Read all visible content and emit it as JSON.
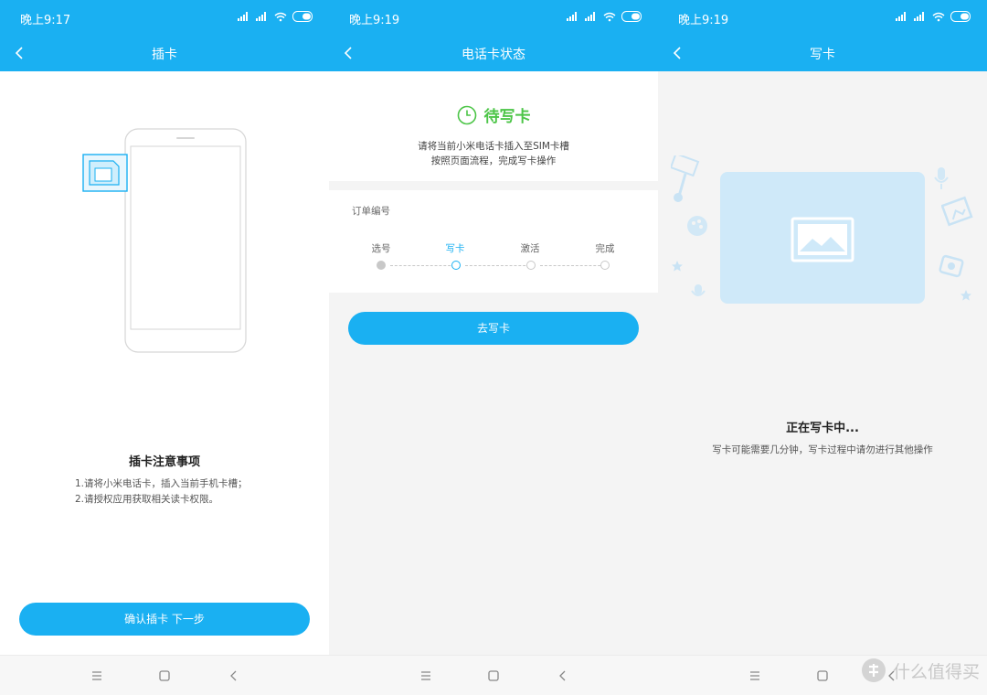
{
  "screens": [
    {
      "status_time": "晚上9:17",
      "title": "插卡",
      "heading": "插卡注意事项",
      "notes": [
        "1.请将小米电话卡，插入当前手机卡槽；",
        "2.请授权应用获取相关读卡权限。"
      ],
      "button_label": "确认插卡 下一步"
    },
    {
      "status_time": "晚上9:19",
      "title": "电话卡状态",
      "status_label": "待写卡",
      "desc_line1": "请将当前小米电话卡插入至SIM卡槽",
      "desc_line2": "按照页面流程，完成写卡操作",
      "order_label": "订单编号",
      "steps": [
        "选号",
        "写卡",
        "激活",
        "完成"
      ],
      "button_label": "去写卡"
    },
    {
      "status_time": "晚上9:19",
      "title": "写卡",
      "heading": "正在写卡中...",
      "desc": "写卡可能需要几分钟，写卡过程中请勿进行其他操作"
    }
  ],
  "watermark": "什么值得买",
  "colors": {
    "accent": "#1ab0f2",
    "success": "#4cc547",
    "background": "#f4f4f4"
  },
  "icons": {
    "back": "back-arrow-icon",
    "clock": "clock-icon",
    "image": "image-placeholder-icon"
  }
}
